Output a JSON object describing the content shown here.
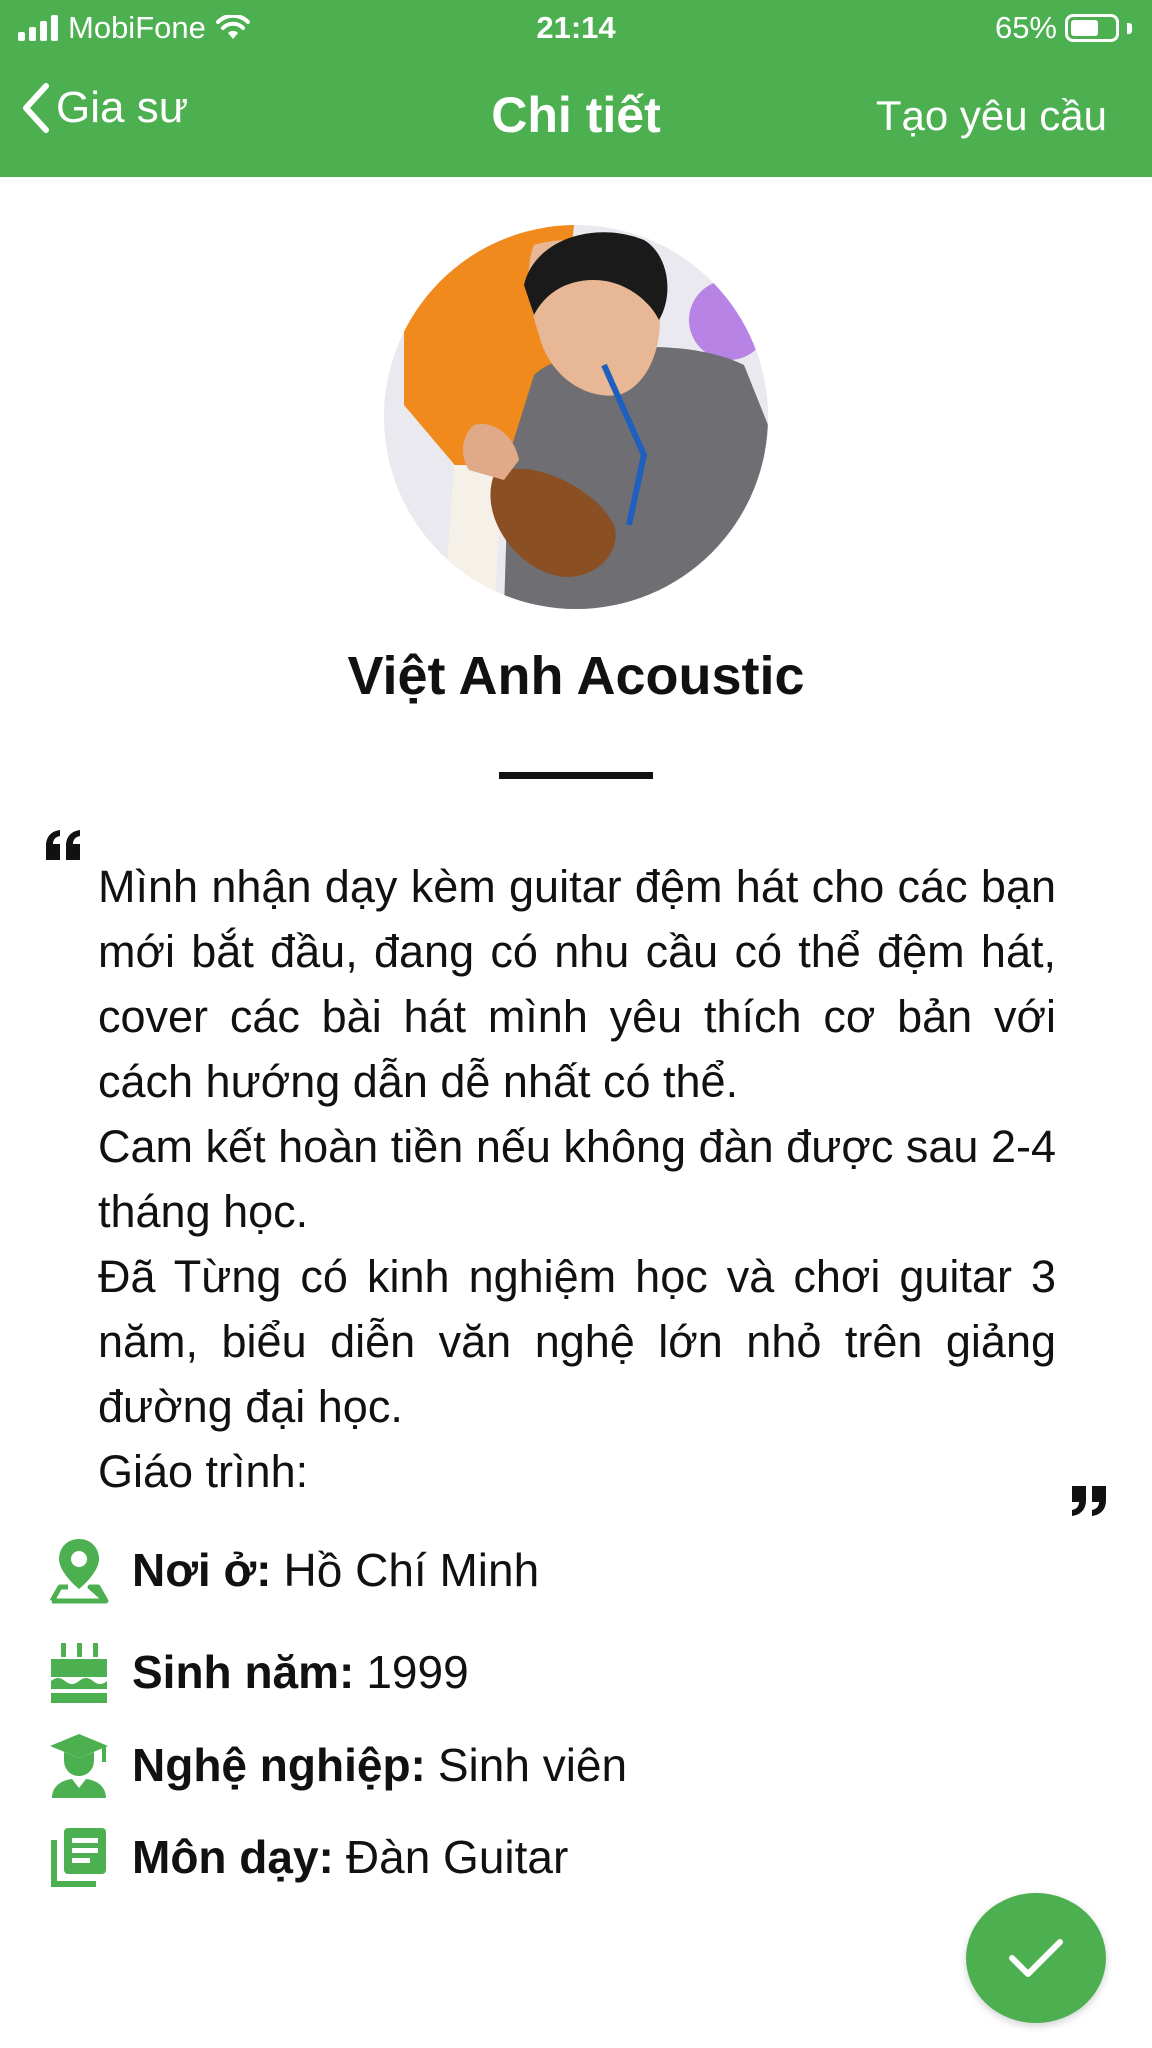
{
  "status_bar": {
    "carrier": "MobiFone",
    "time": "21:14",
    "battery_percent": "65%",
    "battery_level": 0.65
  },
  "nav": {
    "back_label": "Gia sư",
    "title": "Chi tiết",
    "action_label": "Tạo yêu cầu"
  },
  "profile": {
    "name": "Việt Anh Acoustic",
    "bio_lines": [
      "Mình nhận dạy kèm guitar đệm hát cho các bạn mới bắt đầu, đang có nhu cầu có thể đệm hát, cover các bài hát mình yêu thích cơ bản với cách hướng dẫn dễ nhất có thể.",
      "Cam kết hoàn tiền nếu không đàn được sau 2-4 tháng học.",
      "Đã Từng có kinh nghiệm học và chơi guitar 3    năm, biểu diễn văn nghệ lớn nhỏ trên giảng đường đại học.",
      "Giáo trình:"
    ]
  },
  "details": {
    "residence": {
      "label": "Nơi ở:",
      "value": "Hồ Chí Minh",
      "icon": "location-pin-icon"
    },
    "birth_year": {
      "label": "Sinh năm:",
      "value": "1999",
      "icon": "birthday-cake-icon"
    },
    "occupation": {
      "label": "Nghệ nghiệp:",
      "value": "Sinh viên",
      "icon": "graduate-icon"
    },
    "subject": {
      "label": "Môn dạy:",
      "value": "Đàn Guitar",
      "icon": "book-icon"
    }
  },
  "colors": {
    "accent": "#4caf50",
    "text": "#111111"
  },
  "fab": {
    "icon": "checkmark-icon"
  }
}
